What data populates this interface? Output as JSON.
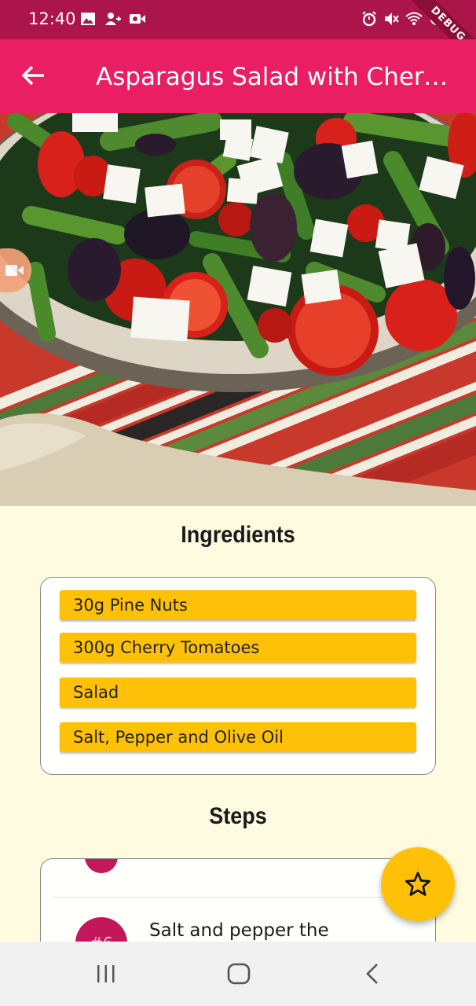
{
  "status_bar": {
    "time": "12:40",
    "left_icons": [
      "image-icon",
      "person-add-icon",
      "video-icon"
    ],
    "right_icons": [
      "alarm-icon",
      "mute-icon",
      "wifi-icon",
      "no-signal-icon"
    ],
    "debug_label": "DEBUG",
    "background": "#ac1549"
  },
  "app_bar": {
    "title": "Asparagus Salad with Cherry Tomatoes",
    "background": "#e91e63"
  },
  "hero_image": {
    "subject": "asparagus-salad-photo"
  },
  "ingredients": {
    "title": "Ingredients",
    "items": [
      "30g Pine Nuts",
      "300g Cherry Tomatoes",
      "Salad",
      "Salt, Pepper and Olive Oil"
    ],
    "chip_color": "#ffc107"
  },
  "steps": {
    "title": "Steps",
    "visible_step_number": "#6",
    "visible_step_text": "Salt and pepper the"
  },
  "fab": {
    "icon": "star-outline-icon",
    "color": "#ffc107"
  },
  "nav_bar": {
    "buttons": [
      "recent-apps-icon",
      "home-icon",
      "back-icon"
    ]
  }
}
